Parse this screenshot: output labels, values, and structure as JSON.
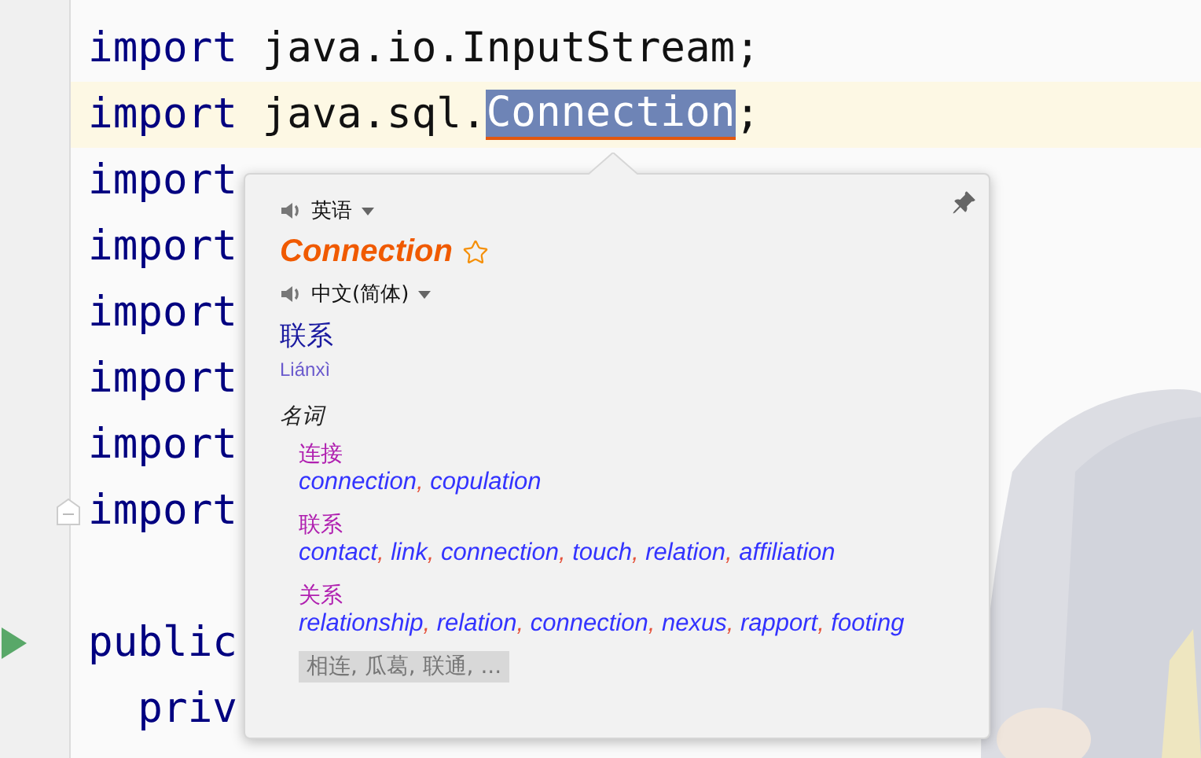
{
  "editor": {
    "lines": [
      {
        "kind": "code",
        "keyword": "import",
        "text": "java.io.InputStream;",
        "current": false
      },
      {
        "kind": "code",
        "keyword": "import",
        "text": "java.sql.",
        "selection": "Connection",
        "after": ";",
        "current": true
      },
      {
        "kind": "code",
        "keyword": "import",
        "current": false
      },
      {
        "kind": "code",
        "keyword": "import",
        "current": false
      },
      {
        "kind": "code",
        "keyword": "import",
        "current": false
      },
      {
        "kind": "code",
        "keyword": "import",
        "current": false
      },
      {
        "kind": "code",
        "keyword": "import",
        "current": false
      },
      {
        "kind": "code",
        "keyword": "import",
        "current": false,
        "gutter": {
          "kind": "fold"
        }
      },
      {
        "kind": "blank"
      },
      {
        "kind": "code",
        "keyword": "public",
        "current": false,
        "gutter": {
          "kind": "run"
        }
      },
      {
        "kind": "code",
        "keyword": "  priv",
        "current": false
      }
    ]
  },
  "popup": {
    "source_language": "英语",
    "word": "Connection",
    "starred": false,
    "target_language": "中文(简体)",
    "translation": "联系",
    "pinyin": "Liánxì",
    "part_of_speech": "名词",
    "senses": [
      {
        "term": "连接",
        "synonyms": "connection, copulation"
      },
      {
        "term": "联系",
        "synonyms": "contact, link, connection, touch, relation, affiliation"
      },
      {
        "term": "关系",
        "synonyms": "relationship, relation, connection, nexus, rapport, footing"
      }
    ],
    "more": "相连, 瓜葛, 联通, ..."
  }
}
